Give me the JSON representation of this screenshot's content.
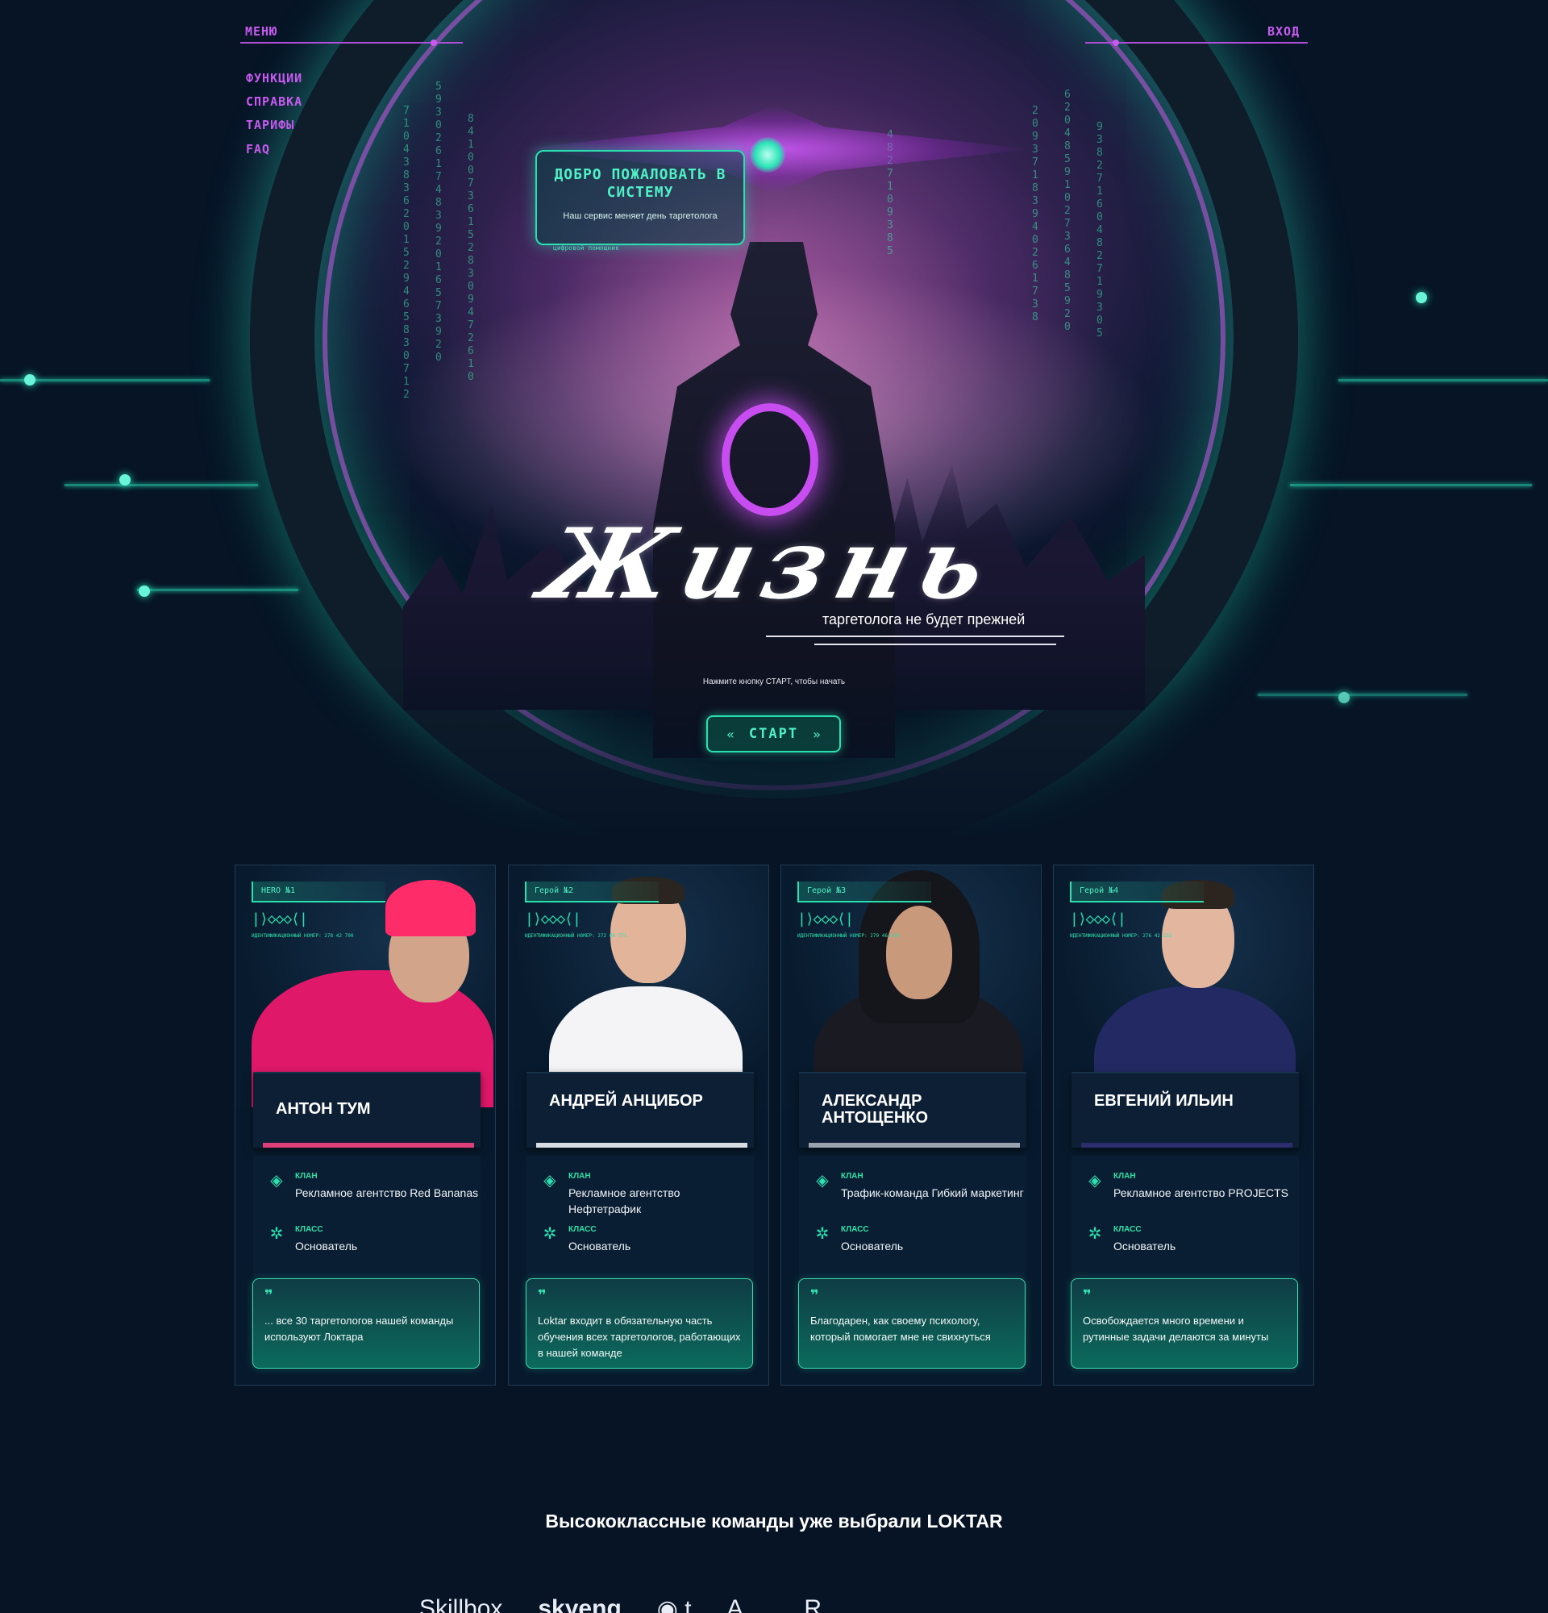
{
  "nav": {
    "menu_label": "МЕНЮ",
    "login_label": "ВХОД",
    "items": [
      {
        "label": "ФУНКЦИИ"
      },
      {
        "label": "СПРАВКА"
      },
      {
        "label": "ТАРИФЫ"
      },
      {
        "label": "FAQ"
      }
    ]
  },
  "hero": {
    "welcome_title": "ДОБРО ПОЖАЛОВАТЬ В СИСТЕМУ",
    "welcome_text": "Наш сервис меняет день таргетолога",
    "welcome_footnote": "цифровой помощник",
    "headline": "Жизнь",
    "subheadline": "таргетолога не будет прежней",
    "hint": "Нажмите кнопку СТАРТ, чтобы начать",
    "start_label": "СТАРТ",
    "start_left_icon": "double-chevron-left",
    "start_right_icon": "double-chevron-right",
    "accent_color": "#28e0b0",
    "menu_color": "#c75bf0"
  },
  "cards": [
    {
      "tag": "HERO №1",
      "dna": "|⟩◇◇◇⟨|",
      "ident": "ИДЕНТИФИКАЦИОННЫЙ НОМЕР: 278 42 700",
      "name": "Антон Тум",
      "clan_label": "КЛАН",
      "clan": "Рекламное агентство Red Bananas",
      "class_label": "КЛАСС",
      "class": "Основатель",
      "quote": "... все 30 таргетологов нашей команды используют Локтара",
      "accent": "#e0407a"
    },
    {
      "tag": "Герой №2",
      "dna": "|⟩◇◇◇⟨|",
      "ident": "ИДЕНТИФИКАЦИОННЫЙ НОМЕР: 272 06 771",
      "name": "Андрей Анцибор",
      "clan_label": "КЛАН",
      "clan": "Рекламное агентство Нефтетрафик",
      "class_label": "КЛАСС",
      "class": "Основатель",
      "quote": "Loktar входит в обязательную часть обучения всех таргетологов, работающих в нашей команде",
      "accent": "#d8dde4"
    },
    {
      "tag": "Герой №3",
      "dna": "|⟩◇◇◇⟨|",
      "ident": "ИДЕНТИФИКАЦИОННЫЙ НОМЕР: 279 46 620",
      "name": "Александр Антощенко",
      "clan_label": "КЛАН",
      "clan": "Трафик-команда Гибкий маркетинг",
      "class_label": "КЛАСС",
      "class": "Основатель",
      "quote": "Благодарен, как своему психологу, который помогает мне не свихнуться",
      "accent": "#9ba4ae"
    },
    {
      "tag": "Герой №4",
      "dna": "|⟩◇◇◇⟨|",
      "ident": "ИДЕНТИФИКАЦИОННЫЙ НОМЕР: 276 42 222",
      "name": "Евгений Ильин",
      "clan_label": "КЛАН",
      "clan": "Рекламное агентство PROJECTS",
      "class_label": "КЛАСС",
      "class": "Основатель",
      "quote": "Освобождается много времени и рутинные задачи делаются за минуты",
      "accent": "#2c2d6e"
    }
  ],
  "clients": {
    "title": "Высококлассные команды уже выбрали LOKTAR",
    "logos": [
      "Skillbox",
      "skyeng",
      "◉ t",
      "A ...",
      "R ..."
    ]
  }
}
